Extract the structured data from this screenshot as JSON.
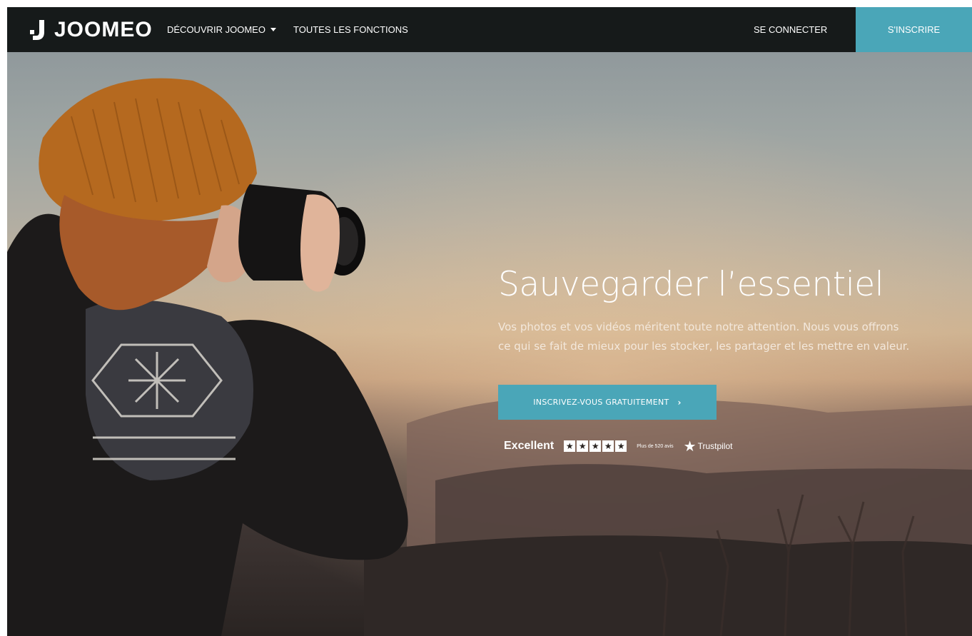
{
  "brand": {
    "name": "JOOMEO"
  },
  "nav": {
    "discover_label": "DÉCOUVRIR JOOMEO",
    "functions_label": "TOUTES LES FONCTIONS",
    "login_label": "SE CONNECTER",
    "signup_label": "S'INSCRIRE"
  },
  "hero": {
    "title": "Sauvegarder l’essentiel",
    "text": "Vos photos et vos vidéos méritent toute notre attention. Nous vous offrons ce qui se fait de mieux pour les stocker, les partager et les mettre en valeur.",
    "cta_label": "INSCRIVEZ-VOUS GRATUITEMENT",
    "cta_arrow": "›"
  },
  "trust": {
    "rating_word": "Excellent",
    "stars": [
      "★",
      "★",
      "★",
      "★",
      "★"
    ],
    "reviews": "Plus de 520 avis",
    "provider": "Trustpilot",
    "provider_star": "★"
  },
  "colors": {
    "accent": "#4aa6b8",
    "navbar": "#161a1a"
  }
}
